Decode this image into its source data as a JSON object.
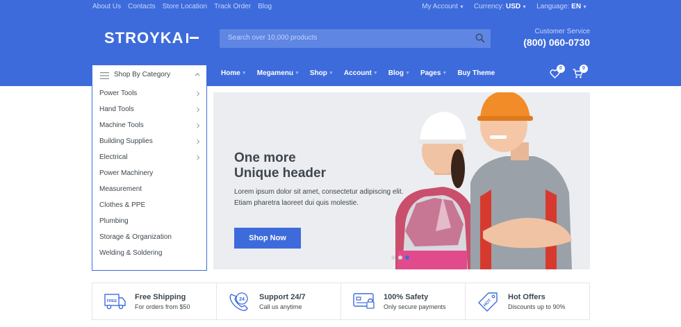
{
  "topbar": {
    "links": [
      "About Us",
      "Contacts",
      "Store Location",
      "Track Order",
      "Blog"
    ],
    "my_account": "My Account",
    "currency_label": "Currency:",
    "currency_value": "USD",
    "language_label": "Language:",
    "language_value": "EN"
  },
  "logo": {
    "text": "STROYKA"
  },
  "search": {
    "placeholder": "Search over 10,000 products"
  },
  "customer_service": {
    "label": "Customer Service",
    "phone": "(800) 060-0730"
  },
  "category_button": {
    "label": "Shop By Category"
  },
  "nav": {
    "items": [
      "Home",
      "Megamenu",
      "Shop",
      "Account",
      "Blog",
      "Pages",
      "Buy Theme"
    ]
  },
  "wishlist": {
    "count": "0"
  },
  "cart": {
    "count": "0"
  },
  "categories": [
    {
      "label": "Power Tools",
      "has_sub": true
    },
    {
      "label": "Hand Tools",
      "has_sub": true
    },
    {
      "label": "Machine Tools",
      "has_sub": true
    },
    {
      "label": "Building Supplies",
      "has_sub": true
    },
    {
      "label": "Electrical",
      "has_sub": true
    },
    {
      "label": "Power Machinery",
      "has_sub": false
    },
    {
      "label": "Measurement",
      "has_sub": false
    },
    {
      "label": "Clothes & PPE",
      "has_sub": false
    },
    {
      "label": "Plumbing",
      "has_sub": false
    },
    {
      "label": "Storage & Organization",
      "has_sub": false
    },
    {
      "label": "Welding & Soldering",
      "has_sub": false
    }
  ],
  "hero": {
    "title_line1": "One more",
    "title_line2": "Unique header",
    "text_line1": "Lorem ipsum dolor sit amet, consectetur adipiscing elit.",
    "text_line2": "Etiam pharetra laoreet dui quis molestie.",
    "button": "Shop Now",
    "slide_count": 3,
    "active_slide": 3
  },
  "features": [
    {
      "icon": "free-delivery-icon",
      "title": "Free Shipping",
      "subtitle": "For orders from $50",
      "badge": "FREE"
    },
    {
      "icon": "support-24-icon",
      "title": "Support 24/7",
      "subtitle": "Call us anytime",
      "badge": "24"
    },
    {
      "icon": "secure-card-icon",
      "title": "100% Safety",
      "subtitle": "Only secure payments"
    },
    {
      "icon": "hot-tag-icon",
      "title": "Hot Offers",
      "subtitle": "Discounts up to 90%",
      "badge": "HOT"
    }
  ],
  "colors": {
    "primary": "#3d6bdc",
    "text": "#3d464d",
    "hero_bg": "#ebedf0",
    "helmet": "#f28c28",
    "overalls": "#d63a2f"
  }
}
